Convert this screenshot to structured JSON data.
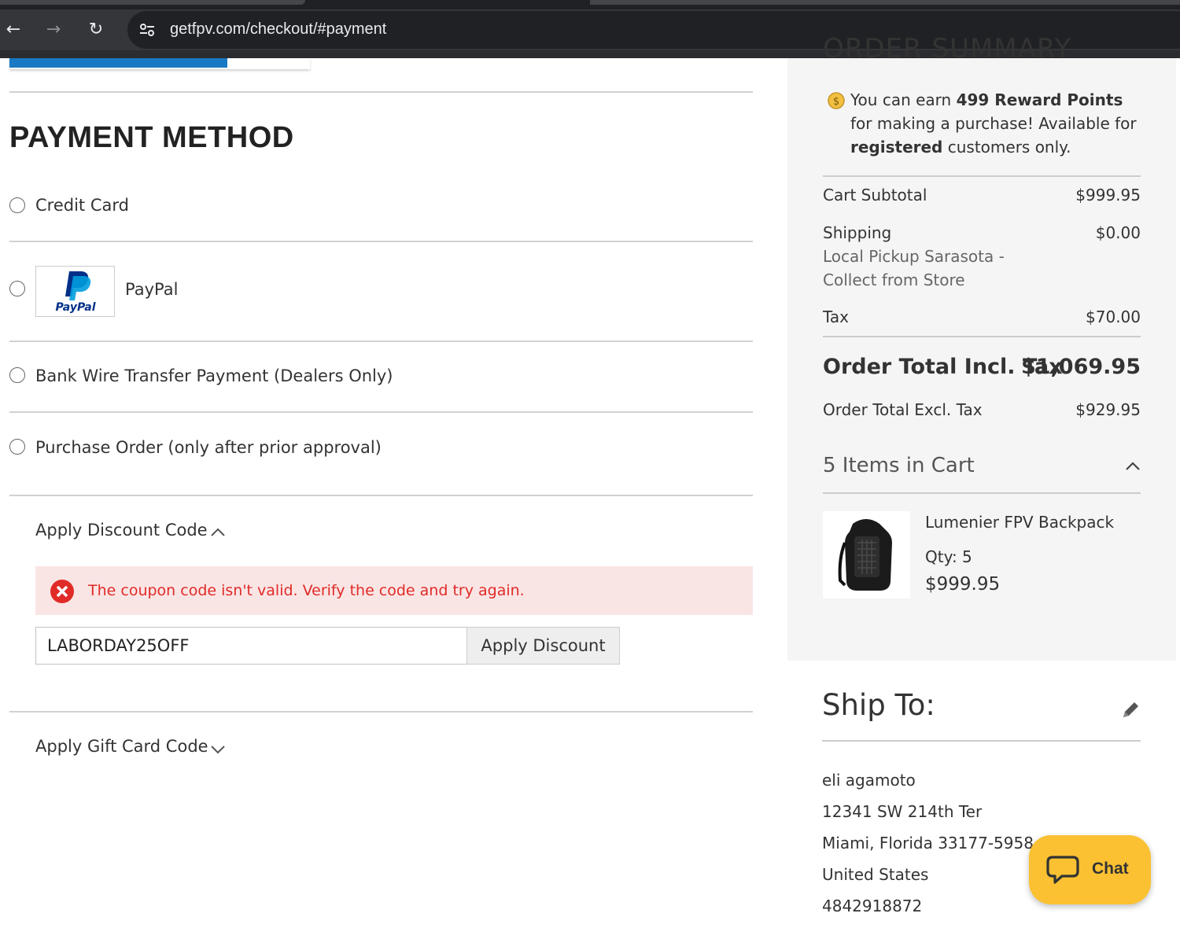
{
  "browser": {
    "url": "getfpv.com/checkout/#payment"
  },
  "payment": {
    "title": "PAYMENT METHOD",
    "options": [
      {
        "label": "Credit Card"
      },
      {
        "label": "PayPal"
      },
      {
        "label": "Bank Wire Transfer Payment (Dealers Only)"
      },
      {
        "label": "Purchase Order (only after prior approval)"
      }
    ],
    "paypal_logo_text": "PayPal"
  },
  "discount": {
    "toggle_label": "Apply Discount Code",
    "error_message": "The coupon code isn't valid. Verify the code and try again.",
    "input_value": "LABORDAY25OFF",
    "button_label": "Apply Discount"
  },
  "gift_card": {
    "toggle_label": "Apply Gift Card Code"
  },
  "summary": {
    "title": "ORDER SUMMARY",
    "reward": {
      "prefix": "You can earn ",
      "points": "499 Reward Points",
      "middle": " for making a purchase! Available for ",
      "registered": "registered",
      "suffix": " customers only."
    },
    "cart_subtotal_label": "Cart Subtotal",
    "cart_subtotal_value": "$999.95",
    "shipping_label": "Shipping",
    "shipping_method_line1": "Local Pickup Sarasota -",
    "shipping_method_line2": "Collect from Store",
    "shipping_value": "$0.00",
    "tax_label": "Tax",
    "tax_value": "$70.00",
    "total_incl_label": "Order Total Incl. Tax",
    "total_incl_value": "$1,069.95",
    "total_excl_label": "Order Total Excl. Tax",
    "total_excl_value": "$929.95",
    "items_heading": "5 Items in Cart",
    "item": {
      "name": "Lumenier FPV Backpack",
      "qty": "Qty: 5",
      "price": "$999.95"
    }
  },
  "ship_to": {
    "title": "Ship To:",
    "name": "eli agamoto",
    "street": "12341 SW 214th Ter",
    "city_line": "Miami, Florida 33177-5958",
    "country": "United States",
    "phone": "4842918872"
  },
  "chat": {
    "label": "Chat"
  },
  "colors": {
    "accent_blue": "#1979c3",
    "error_red": "#e02b27",
    "error_bg": "#fae5e5",
    "chat_yellow": "#fbc132",
    "reward_coin": "#f2c041"
  }
}
